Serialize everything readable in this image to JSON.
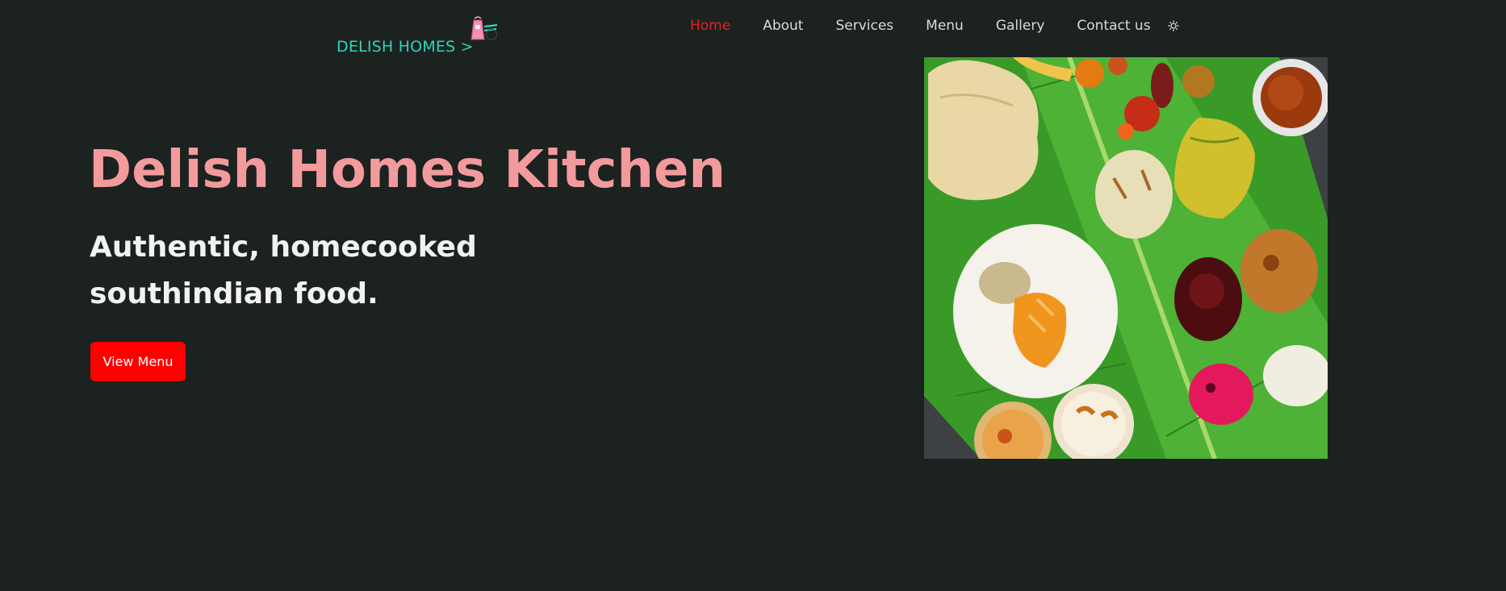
{
  "header": {
    "brand_label": "DELISH HOMES >",
    "logo_icon": "apron-logo-icon",
    "theme_toggle_icon": "sun-icon",
    "nav": [
      {
        "label": "Home",
        "active": true
      },
      {
        "label": "About"
      },
      {
        "label": "Services"
      },
      {
        "label": "Menu"
      },
      {
        "label": "Gallery"
      },
      {
        "label": "Contact us"
      }
    ]
  },
  "hero": {
    "title": "Delish Homes Kitchen",
    "subtitle": "Authentic, homecooked southindian food.",
    "cta_label": "View Menu"
  },
  "colors": {
    "background": "#1b2220",
    "brand": "#2fd5b9",
    "title": "#f39a9d",
    "accent": "#fe0000",
    "nav_active": "#e32222",
    "nav_text": "#dadada"
  }
}
